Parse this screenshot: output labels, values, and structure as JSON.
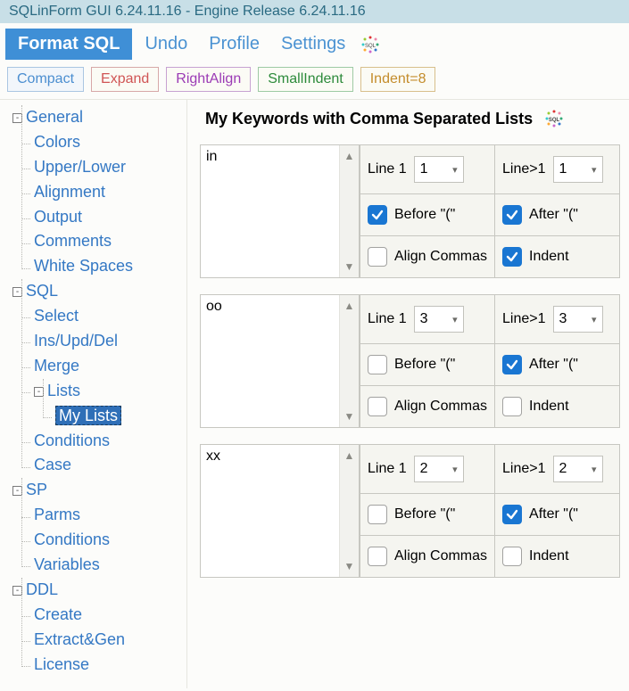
{
  "window": {
    "title": "SQLinForm GUI 6.24.11.16 - Engine Release 6.24.11.16"
  },
  "menubar": {
    "format_sql": "Format SQL",
    "undo": "Undo",
    "profile": "Profile",
    "settings": "Settings"
  },
  "toolbar": {
    "compact": "Compact",
    "expand": "Expand",
    "rightalign": "RightAlign",
    "smallindent": "SmallIndent",
    "indent8": "Indent=8"
  },
  "tree": {
    "general": {
      "label": "General",
      "children": {
        "colors": "Colors",
        "upperlower": "Upper/Lower",
        "alignment": "Alignment",
        "output": "Output",
        "comments": "Comments",
        "whitespaces": "White Spaces"
      }
    },
    "sql": {
      "label": "SQL",
      "children": {
        "select": "Select",
        "insupddel": "Ins/Upd/Del",
        "merge": "Merge",
        "lists": {
          "label": "Lists",
          "children": {
            "mylists": "My Lists"
          }
        },
        "conditions": "Conditions",
        "case": "Case"
      }
    },
    "sp": {
      "label": "SP",
      "children": {
        "parms": "Parms",
        "conditions": "Conditions",
        "variables": "Variables"
      }
    },
    "ddl": {
      "label": "DDL",
      "children": {
        "create": "Create",
        "extractgen": "Extract&Gen",
        "license": "License"
      }
    }
  },
  "page": {
    "heading": "My Keywords with Comma Separated Lists",
    "labels": {
      "line1": "Line 1",
      "lineGT1": "Line>1",
      "before_paren": "Before \"(\"",
      "after_paren": "After \"(\"",
      "align_commas": "Align Commas",
      "indent": "Indent"
    },
    "blocks": [
      {
        "keyword": "in",
        "line1": "1",
        "lineGT1": "1",
        "before_paren": true,
        "after_paren": true,
        "align_commas": false,
        "indent": true
      },
      {
        "keyword": "oo",
        "line1": "3",
        "lineGT1": "3",
        "before_paren": false,
        "after_paren": true,
        "align_commas": false,
        "indent": false
      },
      {
        "keyword": "xx",
        "line1": "2",
        "lineGT1": "2",
        "before_paren": false,
        "after_paren": true,
        "align_commas": false,
        "indent": false
      }
    ]
  }
}
